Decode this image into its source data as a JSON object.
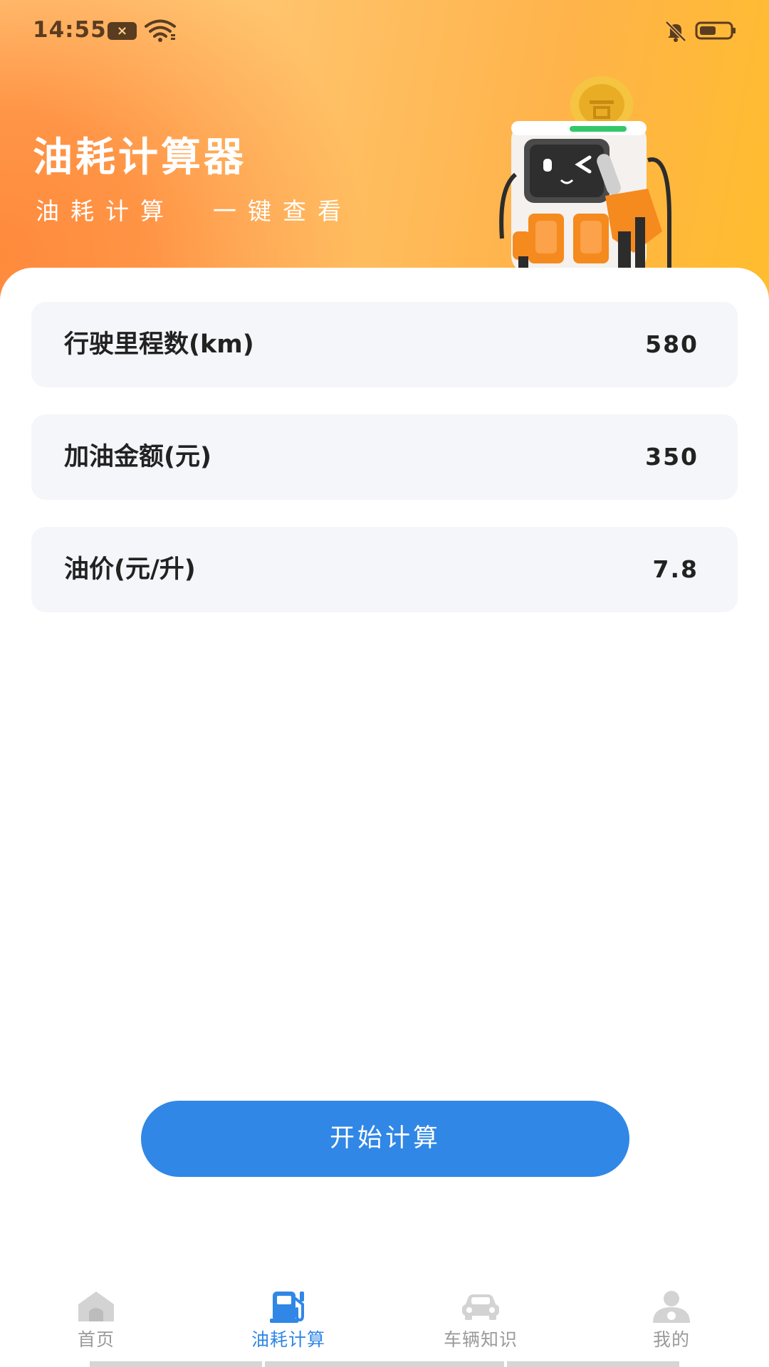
{
  "status_bar": {
    "time": "14:55",
    "notification_badge": "×",
    "icons": [
      "notification-icon",
      "wifi-icon",
      "bell-off-icon",
      "battery-icon"
    ]
  },
  "header": {
    "title": "油耗计算器",
    "subtitle": "油耗计算  一键查看"
  },
  "form": {
    "rows": [
      {
        "label": "行驶里程数(km)",
        "value": "580"
      },
      {
        "label": "加油金额(元)",
        "value": "350"
      },
      {
        "label": "油价(元/升)",
        "value": "7.8"
      }
    ]
  },
  "calc_button": {
    "label": "开始计算"
  },
  "bottom_nav": {
    "items": [
      {
        "label": "首页",
        "icon": "home-icon",
        "active": false
      },
      {
        "label": "油耗计算",
        "icon": "fuel-pump-icon",
        "active": true
      },
      {
        "label": "车辆知识",
        "icon": "car-icon",
        "active": false
      },
      {
        "label": "我的",
        "icon": "user-icon",
        "active": false
      }
    ]
  },
  "colors": {
    "accent": "#3087e6",
    "inactive": "#9a9a9a",
    "header_orange": "#ffb34a",
    "row_bg": "#f5f6fa"
  }
}
